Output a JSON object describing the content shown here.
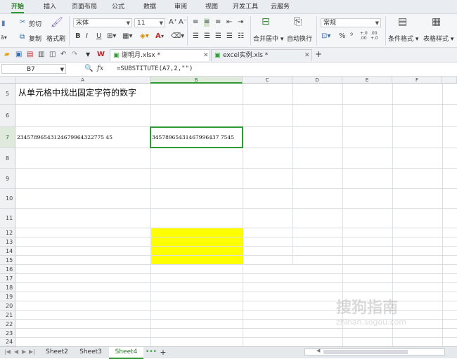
{
  "menu": {
    "tabs": [
      "开始",
      "插入",
      "页面布局",
      "公式",
      "数据",
      "审阅",
      "视图",
      "开发工具",
      "云服务"
    ],
    "active": "开始"
  },
  "ribbon": {
    "cut": "剪切",
    "copy": "复制",
    "format_painter": "格式刷",
    "font_name": "宋体",
    "font_size": "11",
    "bold": "B",
    "italic": "I",
    "underline": "U",
    "merge_center": "合并居中",
    "wrap_text": "自动换行",
    "number_format": "常规",
    "percent": "%",
    "comma": "⁹",
    "inc_decimal": "+.0 .00",
    "dec_decimal": ".00 +.0",
    "conditional_format": "条件格式",
    "table_style": "表格样式",
    "font_color_letter": "A",
    "inc_font": "A⁺",
    "dec_font": "A⁻"
  },
  "doc_tabs": [
    {
      "label": "谢明月.xlsx *",
      "active": true
    },
    {
      "label": "excel实例.xls *",
      "active": false
    }
  ],
  "formula_bar": {
    "name_box": "B7",
    "fx": "fx",
    "formula": "=SUBSTITUTE(A7,2,\"\")"
  },
  "columns": [
    "A",
    "B",
    "C",
    "D",
    "E",
    "F"
  ],
  "rows": [
    "5",
    "6",
    "7",
    "8",
    "9",
    "10",
    "11",
    "12",
    "13",
    "14",
    "15",
    "16",
    "17",
    "18",
    "19",
    "20",
    "21",
    "22",
    "23",
    "24"
  ],
  "cells": {
    "A5": "从单元格中找出固定字符的数字",
    "A7": "23457896543124679964322775 45",
    "B7": "34578965431467996437 7545"
  },
  "sheets": [
    "Sheet2",
    "Sheet3",
    "Sheet4"
  ],
  "active_sheet": "Sheet4",
  "more_sheets": "•••",
  "add_sheet": "+",
  "watermark": {
    "brand": "搜狗指南",
    "url": "zhinan.sogou.com"
  },
  "accent": "#2f9a34",
  "highlight_fill": "#ffff00"
}
